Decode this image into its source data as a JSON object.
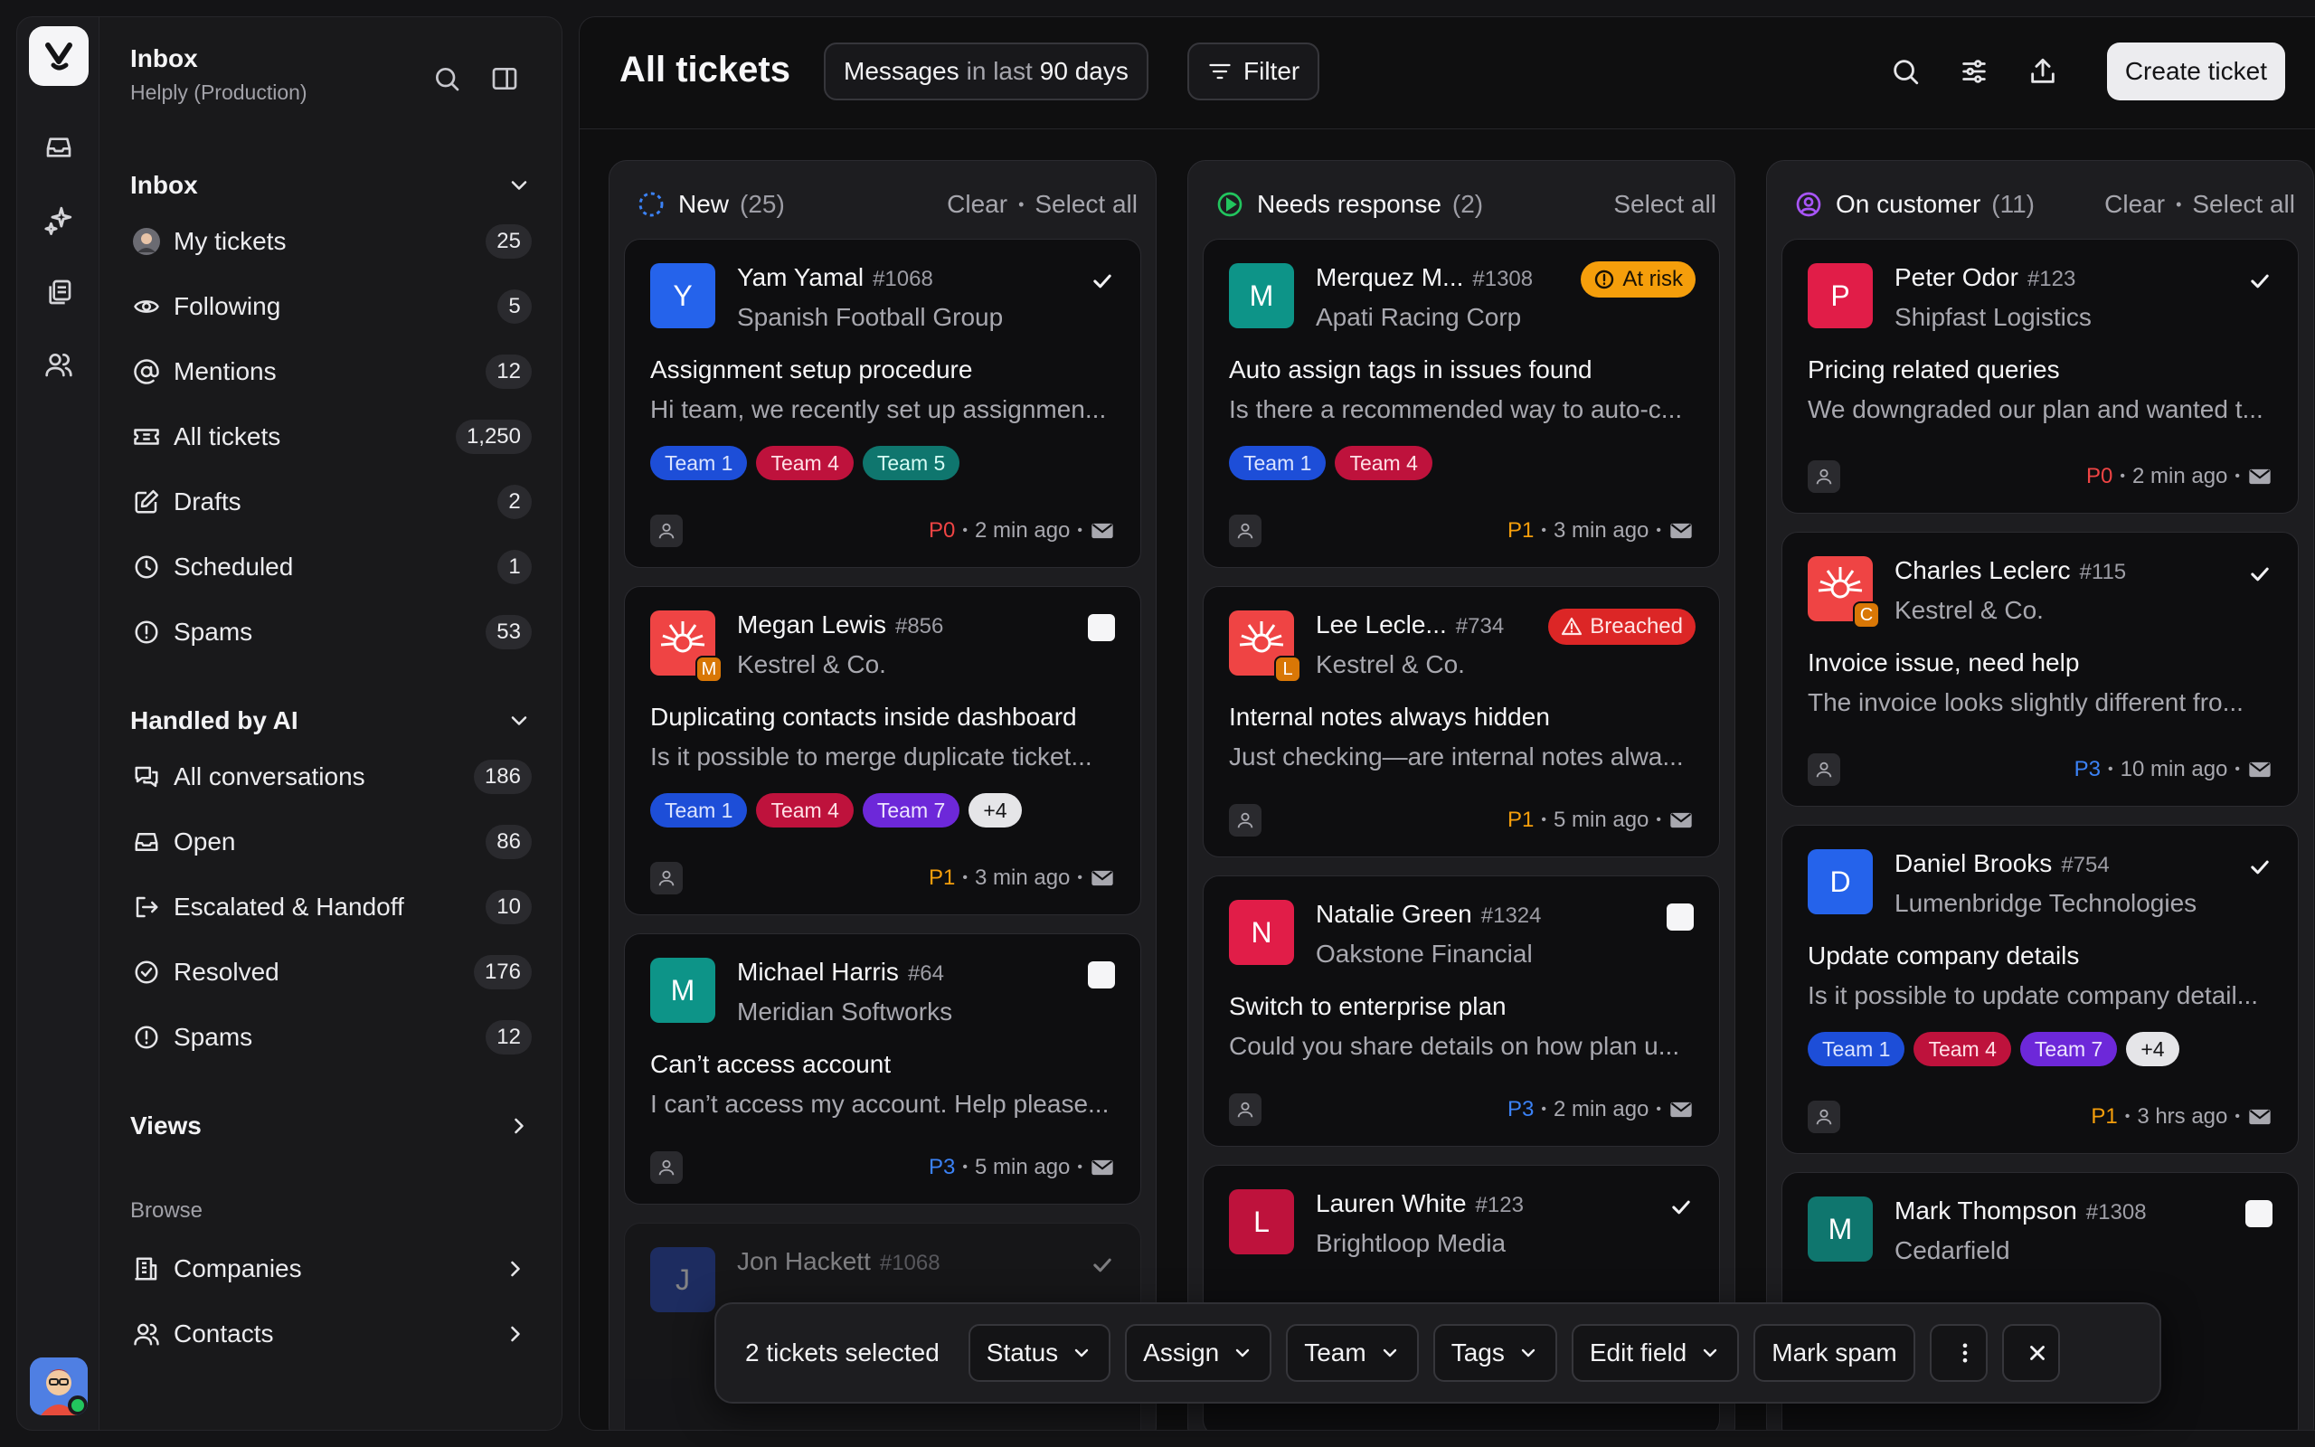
{
  "sidebar": {
    "title": "Inbox",
    "subtitle": "Helply (Production)",
    "inbox_section": "Inbox",
    "inbox_items": [
      {
        "label": "My tickets",
        "count": "25"
      },
      {
        "label": "Following",
        "count": "5"
      },
      {
        "label": "Mentions",
        "count": "12"
      },
      {
        "label": "All tickets",
        "count": "1,250"
      },
      {
        "label": "Drafts",
        "count": "2"
      },
      {
        "label": "Scheduled",
        "count": "1"
      },
      {
        "label": "Spams",
        "count": "53"
      }
    ],
    "ai_section": "Handled by AI",
    "ai_items": [
      {
        "label": "All conversations",
        "count": "186"
      },
      {
        "label": "Open",
        "count": "86"
      },
      {
        "label": "Escalated & Handoff",
        "count": "10"
      },
      {
        "label": "Resolved",
        "count": "176"
      },
      {
        "label": "Spams",
        "count": "12"
      }
    ],
    "views_label": "Views",
    "browse_label": "Browse",
    "browse_items": [
      {
        "label": "Companies"
      },
      {
        "label": "Contacts"
      }
    ]
  },
  "header": {
    "title": "All tickets",
    "filter_pill": {
      "a": "Messages",
      "b": "in last",
      "c": "90 days"
    },
    "filter_label": "Filter",
    "create_label": "Create ticket"
  },
  "columns": [
    {
      "name": "New",
      "count": "(25)",
      "clear": "Clear",
      "select_all": "Select all",
      "cards": [
        {
          "initial": "Y",
          "name": "Yam Yamal",
          "id": "#1068",
          "company": "Spanish Football Group",
          "subject": "Assignment setup procedure",
          "preview": "Hi team, we recently set up assignmen...",
          "tags": [
            "Team 1",
            "Team 4",
            "Team 5"
          ],
          "priority": "P0",
          "time": "2 min ago"
        },
        {
          "initial": "M",
          "name": "Megan Lewis",
          "id": "#856",
          "company": "Kestrel & Co.",
          "subject": "Duplicating contacts inside dashboard",
          "preview": "Is it possible to merge duplicate ticket...",
          "tags": [
            "Team 1",
            "Team 4",
            "Team 7",
            "+4"
          ],
          "priority": "P1",
          "time": "3 min ago"
        },
        {
          "initial": "M",
          "name": "Michael Harris",
          "id": "#64",
          "company": "Meridian Softworks",
          "subject": "Can’t access account",
          "preview": "I can’t access my account. Help please...",
          "priority": "P3",
          "time": "5 min ago"
        },
        {
          "initial": "J",
          "name": "Jon Hackett",
          "id": "#1068"
        }
      ]
    },
    {
      "name": "Needs response",
      "count": "(2)",
      "select_all": "Select all",
      "cards": [
        {
          "initial": "M",
          "name": "Merquez M...",
          "id": "#1308",
          "company": "Apati Racing Corp",
          "badge": "At risk",
          "subject": "Auto assign tags in issues found",
          "preview": "Is there a recommended way to auto-c...",
          "tags": [
            "Team 1",
            "Team 4"
          ],
          "priority": "P1",
          "time": "3 min ago"
        },
        {
          "initial": "L",
          "name": "Lee Lecle...",
          "id": "#734",
          "company": "Kestrel & Co.",
          "badge": "Breached",
          "subject": "Internal notes always hidden",
          "preview": "Just checking—are internal notes alwa...",
          "priority": "P1",
          "time": "5 min ago"
        },
        {
          "initial": "N",
          "name": "Natalie Green",
          "id": "#1324",
          "company": "Oakstone Financial",
          "subject": "Switch to enterprise plan",
          "preview": "Could you share details on how plan u...",
          "priority": "P3",
          "time": "2 min ago"
        },
        {
          "initial": "L",
          "name": "Lauren White",
          "id": "#123",
          "company": "Brightloop Media"
        }
      ]
    },
    {
      "name": "On customer",
      "count": "(11)",
      "clear": "Clear",
      "select_all": "Select all",
      "cards": [
        {
          "initial": "P",
          "name": "Peter Odor",
          "id": "#123",
          "company": "Shipfast Logistics",
          "subject": "Pricing related queries",
          "preview": "We downgraded our plan and wanted t...",
          "priority": "P0",
          "time": "2 min ago"
        },
        {
          "initial": "C",
          "name": "Charles Leclerc",
          "id": "#115",
          "company": "Kestrel & Co.",
          "subject": "Invoice issue, need help",
          "preview": "The invoice looks slightly different fro...",
          "priority": "P3",
          "time": "10 min ago"
        },
        {
          "initial": "D",
          "name": "Daniel Brooks",
          "id": "#754",
          "company": "Lumenbridge Technologies",
          "subject": "Update company details",
          "preview": "Is it possible to update company detail...",
          "tags": [
            "Team 1",
            "Team 4",
            "Team 7",
            "+4"
          ],
          "priority": "P1",
          "time": "3 hrs ago"
        },
        {
          "initial": "M",
          "name": "Mark Thompson",
          "id": "#1308",
          "company": "Cedarfield"
        }
      ]
    }
  ],
  "actionbar": {
    "selected": "2 tickets selected",
    "status": "Status",
    "assign": "Assign",
    "team": "Team",
    "tags": "Tags",
    "edit_field": "Edit field",
    "mark_spam": "Mark spam"
  }
}
